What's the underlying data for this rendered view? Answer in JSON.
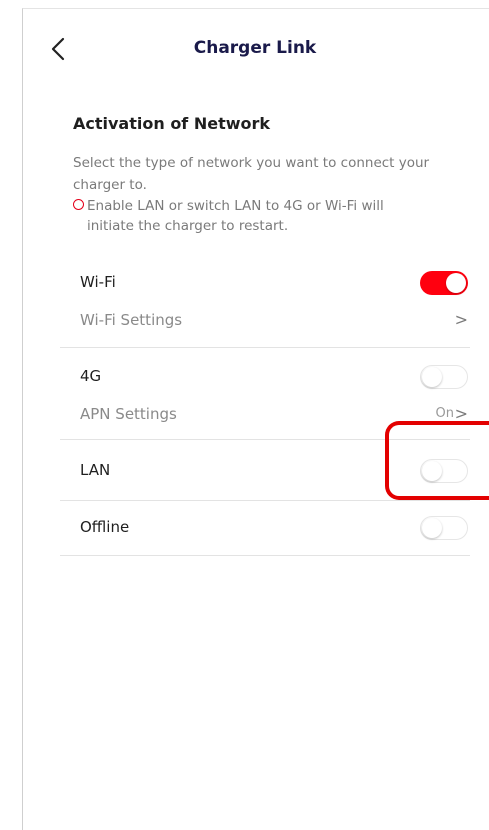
{
  "header": {
    "title": "Charger Link",
    "back_icon": "chevron-left-icon"
  },
  "section": {
    "title": "Activation of Network",
    "description": "Select the type of network you want to connect your charger to.",
    "warning_line1": "Enable LAN or switch LAN to 4G or Wi-Fi will",
    "warning_line2": "initiate the charger to restart."
  },
  "networks": {
    "wifi": {
      "label": "Wi-Fi",
      "enabled": true,
      "settings_label": "Wi-Fi Settings"
    },
    "g4": {
      "label": "4G",
      "enabled": false,
      "settings_label": "APN Settings",
      "settings_value": "On"
    },
    "lan": {
      "label": "LAN",
      "enabled": false
    },
    "offline": {
      "label": "Offline",
      "enabled": false
    }
  },
  "colors": {
    "accent": "#ff000f",
    "title": "#1a1a4a",
    "muted": "#7a7a7a",
    "highlight": "#e30000"
  },
  "chevron_glyph": ">"
}
